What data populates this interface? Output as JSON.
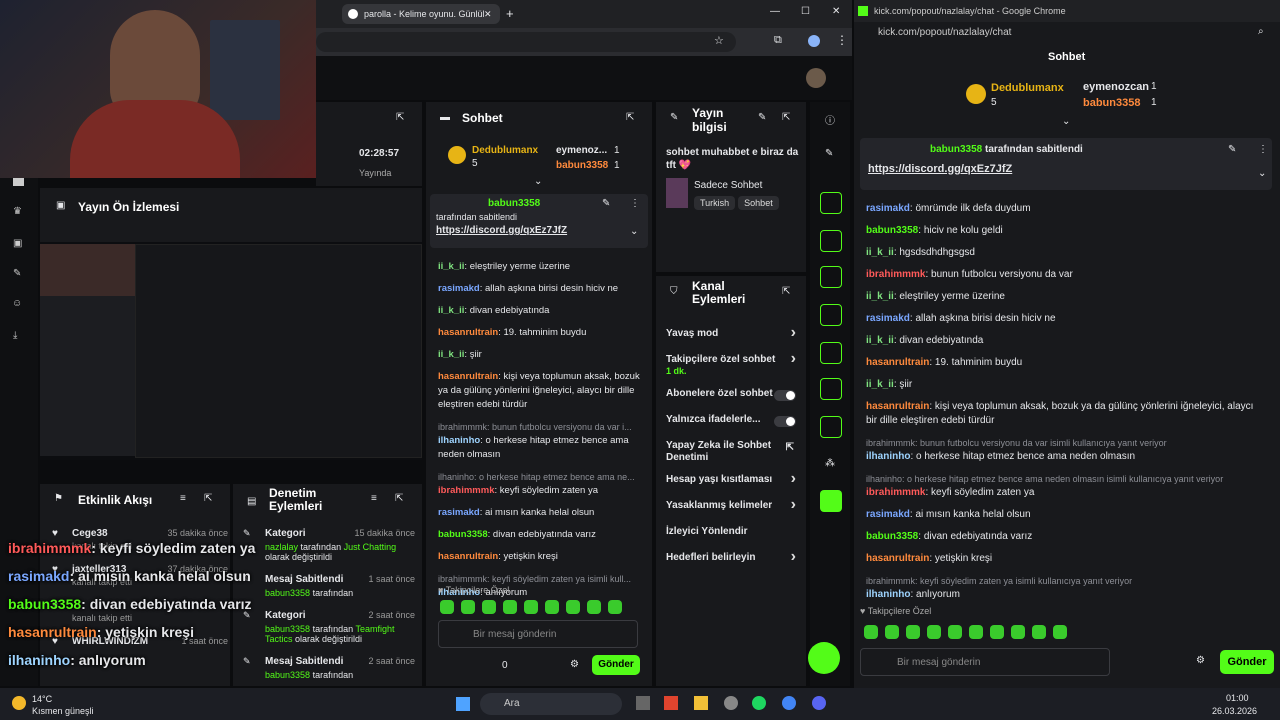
{
  "webcam": {
    "label": "webcam-person"
  },
  "left_browser": {
    "tab_title": "parolla - Kelime oyunu. Günlük",
    "win_controls": [
      "—",
      "☐",
      "✕"
    ],
    "stream_time": "02:28:57",
    "stream_status": "Yayında",
    "stream_preview_title": "Yayın Ön İzlemesi",
    "activity_title": "Etkinlik Akışı",
    "activity": [
      {
        "user": "Cege38",
        "time": "35 dakika önce",
        "sub": "kanalı takip etti"
      },
      {
        "user": "jaxteller313",
        "time": "37 dakika önce",
        "sub": "kanalı takip etti"
      },
      {
        "user": "",
        "time": "",
        "sub": "kanalı takip etti"
      },
      {
        "user": "WHIRLWINDIZM",
        "time": "1 saat önce",
        "sub": ""
      }
    ],
    "mod_title": "Denetim Eylemleri",
    "mod": [
      {
        "action": "Kategori",
        "time": "15 dakika önce",
        "user": "nazlalay",
        "mid": "tarafından",
        "hl": "Just Chatting",
        "rest": "olarak değiştirildi"
      },
      {
        "action": "Mesaj Sabitlendi",
        "time": "1 saat önce",
        "user": "babun3358",
        "mid": "tarafından",
        "hl": "",
        "rest": ""
      },
      {
        "action": "Kategori",
        "time": "2 saat önce",
        "user": "babun3358",
        "mid": "tarafından",
        "hl": "Teamfight Tactics",
        "rest": "olarak değiştirildi"
      },
      {
        "action": "Mesaj Sabitlendi",
        "time": "2 saat önce",
        "user": "babun3358",
        "mid": "tarafından",
        "hl": "",
        "rest": ""
      }
    ],
    "chat_title": "Sohbet",
    "leaders": [
      {
        "name": "Dedublumanx",
        "count": "5"
      },
      {
        "name": "eymenoz...",
        "count": "1"
      },
      {
        "name": "babun3358",
        "count": "1"
      }
    ],
    "pinned": {
      "user": "babun3358",
      "label": "tarafından sabitlendi",
      "link": "https://discord.gg/qxEz7JfZ"
    },
    "messages": [
      {
        "user": "ii_k_ii",
        "c": "u3",
        "text": "eleştriley yerme üzerine"
      },
      {
        "user": "rasimakd",
        "c": "u2",
        "text": "allah aşkına birisi desin hiciv ne"
      },
      {
        "user": "ii_k_ii",
        "c": "u3",
        "text": "divan edebiyatında"
      },
      {
        "user": "hasanrultrain",
        "c": "u4",
        "text": "19. tahminim buydu"
      },
      {
        "user": "ii_k_ii",
        "c": "u3",
        "text": "şiir"
      },
      {
        "user": "hasanrultrain",
        "c": "u4",
        "text": "kişi veya toplumun aksak, bozuk ya da gülünç yönlerini iğneleyici, alaycı bir dille eleştiren edebi türdür"
      },
      {
        "reply": "ibrahimmmk: bunun futbolcu versiyonu da var i...",
        "user": "ilhaninho",
        "c": "u5",
        "text": "o herkese hitap etmez bence ama neden olmasın"
      },
      {
        "reply": "ilhaninho: o herkese hitap etmez bence ama ne...",
        "user": "ibrahimmmk",
        "c": "u1",
        "text": "keyfi söyledim zaten ya"
      },
      {
        "user": "rasimakd",
        "c": "u2",
        "text": "ai mısın kanka helal olsun"
      },
      {
        "user": "babun3358",
        "c": "g",
        "text": "divan edebiyatında varız"
      },
      {
        "user": "hasanrultrain",
        "c": "u4",
        "text": "yetişkin kreşi"
      },
      {
        "reply": "ibrahimmmk: keyfi söyledim zaten ya isimli kull...",
        "user": "ilhaninho",
        "c": "u5",
        "text": "anlıyorum"
      }
    ],
    "follower_only": "Takipçilere Özel",
    "input_placeholder": "Bir mesaj gönderin",
    "send": "Gönder",
    "points": "0",
    "info_title": "Yayın bilgisi",
    "info_text": "sohbet muhabbet e biraz da tft 💖",
    "info_cat": "Sadece Sohbet",
    "info_tags": [
      "Turkish",
      "Sohbet"
    ],
    "channel_title": "Kanal Eylemleri",
    "channel": [
      {
        "label": "Yavaş mod",
        "sub": "",
        "ctl": "chev"
      },
      {
        "label": "Takipçilere özel sohbet",
        "sub": "1 dk.",
        "ctl": "chev"
      },
      {
        "label": "Abonelere özel sohbet",
        "sub": "",
        "ctl": "toggle"
      },
      {
        "label": "Yalnızca ifadelerle...",
        "sub": "",
        "ctl": "toggle"
      },
      {
        "label": "Yapay Zeka ile Sohbet Denetimi",
        "sub": "",
        "ctl": "ext"
      },
      {
        "label": "Hesap yaşı kısıtlaması",
        "sub": "",
        "ctl": "chev"
      },
      {
        "label": "Yasaklanmış kelimeler",
        "sub": "",
        "ctl": "chev"
      },
      {
        "label": "İzleyici Yönlendir",
        "sub": "",
        "ctl": ""
      },
      {
        "label": "Hedefleri belirleyin",
        "sub": "",
        "ctl": "chev"
      }
    ]
  },
  "right_window": {
    "title": "kick.com/popout/nazlalay/chat - Google Chrome",
    "url": "kick.com/popout/nazlalay/chat",
    "header": "Sohbet",
    "leaders": [
      {
        "name": "Dedublumanx",
        "count": "5"
      },
      {
        "name": "eymenozcan",
        "count": "1"
      },
      {
        "name": "babun3358",
        "count": "1"
      }
    ],
    "pinned": {
      "user": "babun3358",
      "label": "tarafından sabitlendi",
      "link": "https://discord.gg/qxEz7JfZ"
    },
    "messages": [
      {
        "user": "rasimakd",
        "c": "u2",
        "text": "ömrümde ilk defa duydum"
      },
      {
        "user": "babun3358",
        "c": "g",
        "text": "hiciv ne kolu geldi"
      },
      {
        "user": "ii_k_ii",
        "c": "u3",
        "text": "hgsdsdhdhgsgsd"
      },
      {
        "user": "ibrahimmmk",
        "c": "u1",
        "text": "bunun futbolcu versiyonu da var"
      },
      {
        "user": "ii_k_ii",
        "c": "u3",
        "text": "eleştriley yerme üzerine"
      },
      {
        "user": "rasimakd",
        "c": "u2",
        "text": "allah aşkına birisi desin hiciv ne"
      },
      {
        "user": "ii_k_ii",
        "c": "u3",
        "text": "divan edebiyatında"
      },
      {
        "user": "hasanrultrain",
        "c": "u4",
        "text": "19. tahminim buydu"
      },
      {
        "user": "ii_k_ii",
        "c": "u3",
        "text": "şiir"
      },
      {
        "user": "hasanrultrain",
        "c": "u4",
        "text": "kişi veya toplumun aksak, bozuk ya da gülünç yönlerini iğneleyici, alaycı bir dille eleştiren edebi türdür"
      },
      {
        "reply": "ibrahimmmk: bunun futbolcu versiyonu da var isimli kullanıcıya yanıt veriyor",
        "user": "ilhaninho",
        "c": "u5",
        "text": "o herkese hitap etmez bence ama neden olmasın"
      },
      {
        "reply": "ilhaninho: o herkese hitap etmez bence ama neden olmasın isimli kullanıcıya yanıt veriyor",
        "user": "ibrahimmmk",
        "c": "u1",
        "text": "keyfi söyledim zaten ya"
      },
      {
        "user": "rasimakd",
        "c": "u2",
        "text": "ai mısın kanka helal olsun"
      },
      {
        "user": "babun3358",
        "c": "g",
        "text": "divan edebiyatında varız"
      },
      {
        "user": "hasanrultrain",
        "c": "u4",
        "text": "yetişkin kreşi"
      },
      {
        "reply": "ibrahimmmk: keyfi söyledim zaten ya isimli kullanıcıya yanıt veriyor",
        "user": "ilhaninho",
        "c": "u5",
        "text": "anlıyorum"
      }
    ],
    "follower_only": "Takipçilere Özel",
    "input_placeholder": "Bir mesaj gönderin",
    "send": "Gönder"
  },
  "overlay": [
    {
      "user": "ibrahimmmk",
      "c": "u1",
      "text": ": keyfi söyledim zaten ya"
    },
    {
      "user": "rasimakd",
      "c": "u2",
      "text": ": ai mısın kanka helal olsun"
    },
    {
      "user": "babun3358",
      "c": "g",
      "text": ": divan edebiyatında varız"
    },
    {
      "user": "hasanrultrain",
      "c": "u4",
      "text": ": yetişkin kreşi"
    },
    {
      "user": "ilhaninho",
      "c": "u5",
      "text": ": anlıyorum"
    }
  ],
  "taskbar": {
    "temp": "14°C",
    "weather": "Kısmen güneşli",
    "search": "Ara",
    "time": "01:00",
    "date": "26.03.2026"
  }
}
